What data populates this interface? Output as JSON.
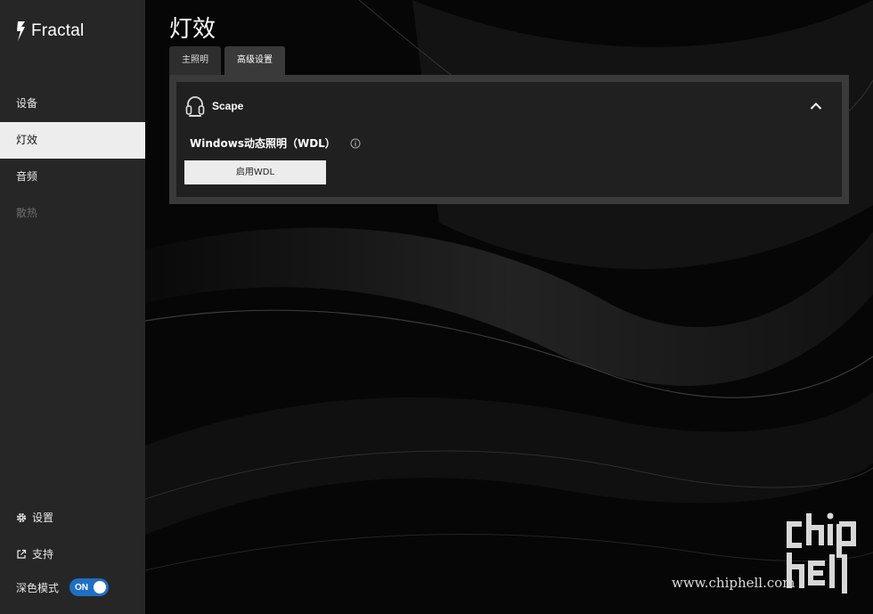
{
  "app": {
    "logo_text": "Fractal"
  },
  "sidebar": {
    "items": [
      {
        "label": "设备",
        "state": "normal"
      },
      {
        "label": "灯效",
        "state": "active"
      },
      {
        "label": "音频",
        "state": "normal"
      },
      {
        "label": "散热",
        "state": "disabled"
      }
    ],
    "bottom": {
      "settings_label": "设置",
      "support_label": "支持",
      "dark_mode_label": "深色模式",
      "dark_mode_toggle": "ON"
    }
  },
  "main": {
    "title": "灯效",
    "tabs": [
      {
        "label": "主照明",
        "active": false
      },
      {
        "label": "高级设置",
        "active": true
      }
    ],
    "panel": {
      "device_name": "Scape",
      "wdl_title": "Windows动态照明（WDL）",
      "wdl_button": "启用WDL"
    }
  },
  "watermark": {
    "url": "www.chiphell.com"
  },
  "colors": {
    "accent": "#1f6fc4",
    "sidebar_bg": "#262626",
    "active_item_bg": "#ededed"
  }
}
